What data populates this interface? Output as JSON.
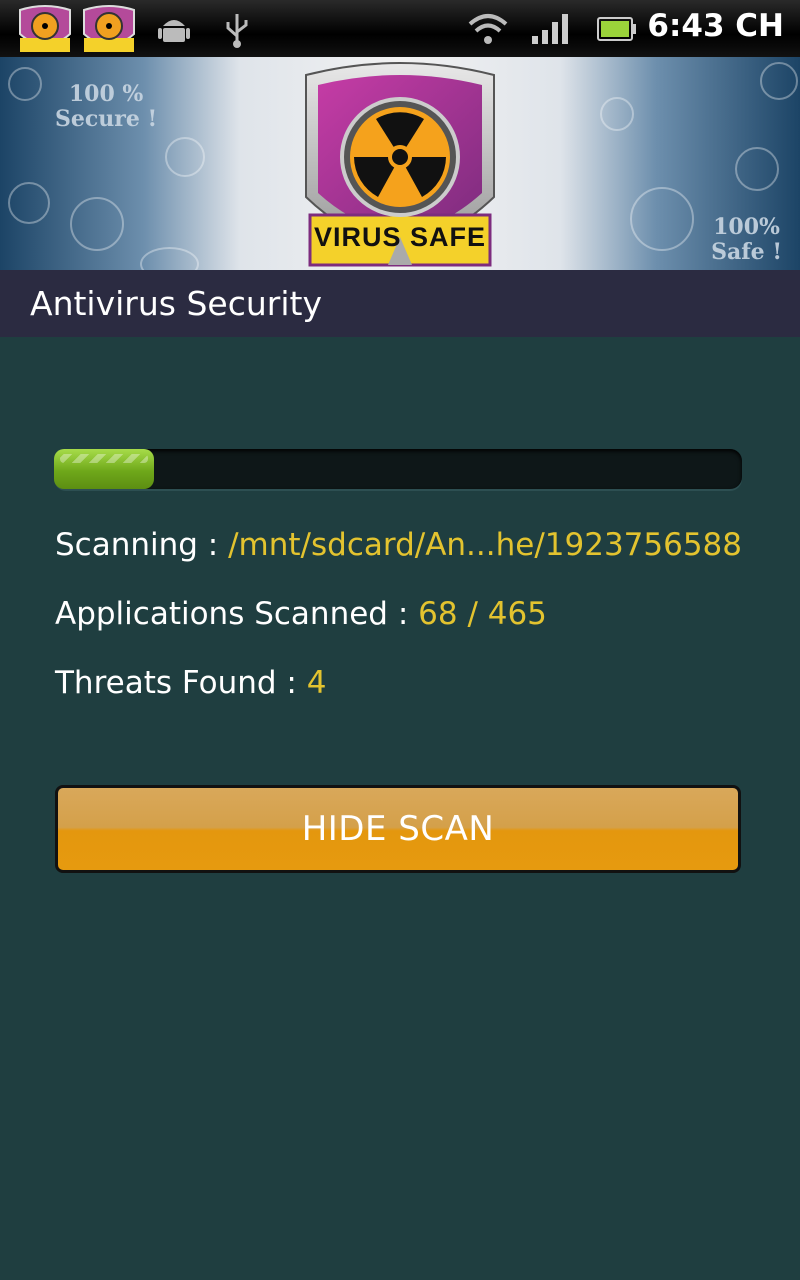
{
  "status_bar": {
    "time": "6:43 CH",
    "notification_icons": [
      "virus-safe-app-icon",
      "virus-safe-app-icon",
      "android-icon",
      "usb-icon"
    ],
    "system_icons": [
      "wifi-icon",
      "signal-icon",
      "battery-icon"
    ]
  },
  "banner": {
    "left_text": "100 %\nSecure !",
    "right_text": "100%\nSafe !",
    "logo_text": "VIRUS SAFE"
  },
  "title_bar": {
    "title": "Antivirus Security"
  },
  "scan": {
    "progress_fraction": 0.146,
    "scanning_label": "Scanning : ",
    "scanning_value": "/mnt/sdcard/An...he/1923756588",
    "apps_label": "Applications Scanned : ",
    "apps_value": "68 / 465",
    "threats_label": "Threats Found : ",
    "threats_value": "4"
  },
  "buttons": {
    "hide_scan": "HIDE SCAN"
  },
  "colors": {
    "background": "#1f3e40",
    "title_bar": "#2b2b41",
    "value_text": "#e3c32f",
    "progress_green": "#7dbb22",
    "button_orange": "#e69a0f"
  }
}
